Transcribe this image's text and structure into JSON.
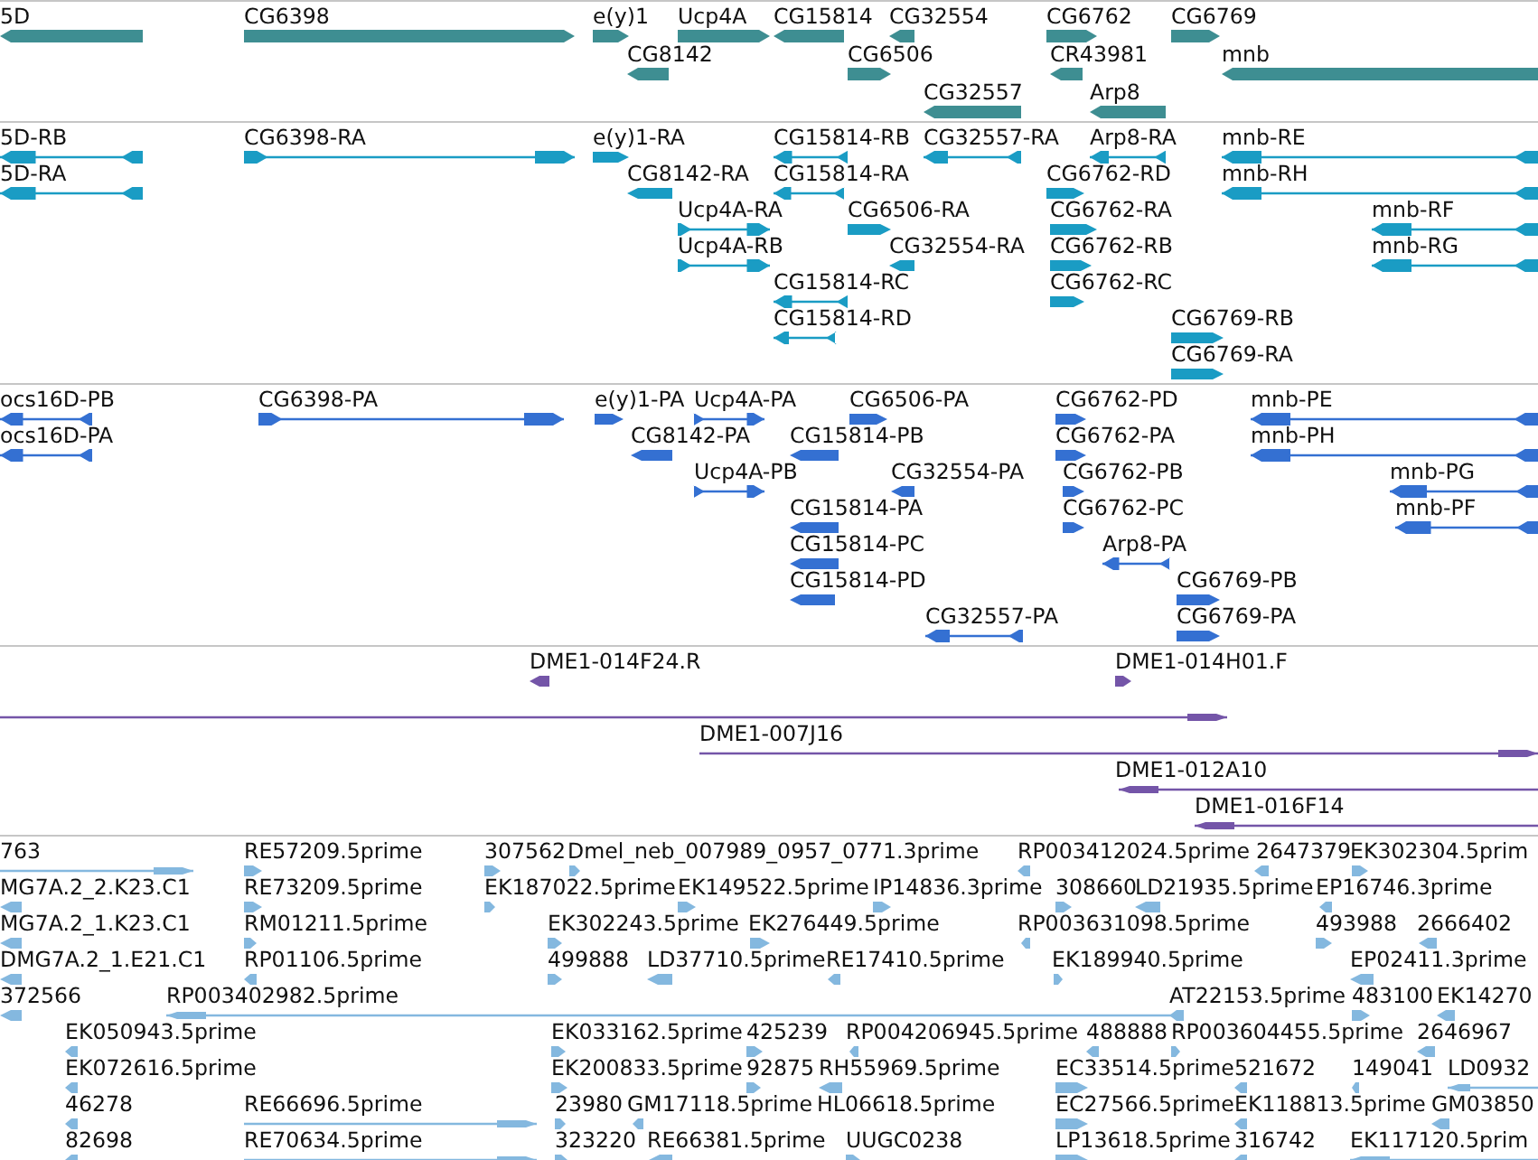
{
  "tracks": [
    {
      "kind": "gene",
      "color": "#3e8e92",
      "features": [
        {
          "label": "5D",
          "forward": false
        },
        {
          "label": "CG6398",
          "forward": true
        },
        {
          "label": "e(y)1",
          "forward": true
        },
        {
          "label": "Ucp4A",
          "forward": true
        },
        {
          "label": "CG15814",
          "forward": false
        },
        {
          "label": "CG32554",
          "forward": false
        },
        {
          "label": "CG6762",
          "forward": true
        },
        {
          "label": "CG6769",
          "forward": true
        },
        {
          "label": "CG8142",
          "forward": false
        },
        {
          "label": "CG6506",
          "forward": true
        },
        {
          "label": "CR43981",
          "forward": false
        },
        {
          "label": "mnb",
          "forward": false
        },
        {
          "label": "CG32557",
          "forward": false
        },
        {
          "label": "Arp8",
          "forward": false
        }
      ]
    },
    {
      "kind": "transcript",
      "color": "#1a9cc4",
      "features": [
        {
          "label": "5D-RB",
          "forward": false
        },
        {
          "label": "CG6398-RA",
          "forward": true
        },
        {
          "label": "e(y)1-RA",
          "forward": true
        },
        {
          "label": "CG15814-RB",
          "forward": false
        },
        {
          "label": "CG32557-RA",
          "forward": false
        },
        {
          "label": "Arp8-RA",
          "forward": false
        },
        {
          "label": "mnb-RE",
          "forward": false
        },
        {
          "label": "5D-RA",
          "forward": false
        },
        {
          "label": "CG8142-RA",
          "forward": false
        },
        {
          "label": "CG15814-RA",
          "forward": false
        },
        {
          "label": "CG6762-RD",
          "forward": true
        },
        {
          "label": "mnb-RH",
          "forward": false
        },
        {
          "label": "Ucp4A-RA",
          "forward": true
        },
        {
          "label": "CG6506-RA",
          "forward": true
        },
        {
          "label": "CG6762-RA",
          "forward": true
        },
        {
          "label": "mnb-RF",
          "forward": false
        },
        {
          "label": "Ucp4A-RB",
          "forward": true
        },
        {
          "label": "CG32554-RA",
          "forward": false
        },
        {
          "label": "CG6762-RB",
          "forward": true
        },
        {
          "label": "mnb-RG",
          "forward": false
        },
        {
          "label": "CG15814-RC",
          "forward": false
        },
        {
          "label": "CG6762-RC",
          "forward": true
        },
        {
          "label": "CG15814-RD",
          "forward": false
        },
        {
          "label": "CG6769-RB",
          "forward": true
        },
        {
          "label": "CG6769-RA",
          "forward": true
        }
      ]
    },
    {
      "kind": "protein",
      "color": "#3470d2",
      "features": [
        {
          "label": "ocs16D-PB",
          "forward": false
        },
        {
          "label": "CG6398-PA",
          "forward": true
        },
        {
          "label": "e(y)1-PA",
          "forward": true
        },
        {
          "label": "Ucp4A-PA",
          "forward": true
        },
        {
          "label": "CG6506-PA",
          "forward": true
        },
        {
          "label": "CG6762-PD",
          "forward": true
        },
        {
          "label": "mnb-PE",
          "forward": false
        },
        {
          "label": "ocs16D-PA",
          "forward": false
        },
        {
          "label": "CG8142-PA",
          "forward": false
        },
        {
          "label": "CG15814-PB",
          "forward": false
        },
        {
          "label": "CG6762-PA",
          "forward": true
        },
        {
          "label": "mnb-PH",
          "forward": false
        },
        {
          "label": "Ucp4A-PB",
          "forward": true
        },
        {
          "label": "CG32554-PA",
          "forward": false
        },
        {
          "label": "CG6762-PB",
          "forward": true
        },
        {
          "label": "mnb-PG",
          "forward": false
        },
        {
          "label": "CG15814-PA",
          "forward": false
        },
        {
          "label": "CG6762-PC",
          "forward": true
        },
        {
          "label": "mnb-PF",
          "forward": false
        },
        {
          "label": "CG15814-PC",
          "forward": false
        },
        {
          "label": "Arp8-PA",
          "forward": false
        },
        {
          "label": "CG15814-PD",
          "forward": false
        },
        {
          "label": "CG6769-PB",
          "forward": true
        },
        {
          "label": "CG32557-PA",
          "forward": false
        },
        {
          "label": "CG6769-PA",
          "forward": true
        }
      ]
    },
    {
      "kind": "clone",
      "color": "#7455a8",
      "features": [
        {
          "label": "DME1-014F24.R",
          "forward": false
        },
        {
          "label": "DME1-014H01.F",
          "forward": true
        },
        {
          "forward": true
        },
        {
          "label": "DME1-007J16",
          "forward": true
        },
        {
          "label": "DME1-012A10",
          "forward": false
        },
        {
          "label": "DME1-016F14",
          "forward": false
        }
      ]
    },
    {
      "kind": "est",
      "color": "#84b8df",
      "features": [
        {
          "label": "763",
          "forward": true
        },
        {
          "label": "RE57209.5prime",
          "forward": true
        },
        {
          "label": "307562",
          "forward": true
        },
        {
          "label": "Dmel_neb_007989_0957_0771.3prime",
          "forward": true
        },
        {
          "label": "RP003412024.5prime",
          "forward": false
        },
        {
          "label": "2647379",
          "forward": false
        },
        {
          "label": "EK302304.5prim",
          "forward": true
        },
        {
          "label": "MG7A.2_2.K23.C1",
          "forward": false
        },
        {
          "label": "RE73209.5prime",
          "forward": true
        },
        {
          "label": "EK187022.5prime",
          "forward": true
        },
        {
          "label": "EK149522.5prime",
          "forward": true
        },
        {
          "label": "IP14836.3prime",
          "forward": true
        },
        {
          "label": "308660",
          "forward": true
        },
        {
          "label": "LD21935.5prime",
          "forward": false
        },
        {
          "label": "EP16746.3prime",
          "forward": false
        },
        {
          "label": "MG7A.2_1.K23.C1",
          "forward": false
        },
        {
          "label": "RM01211.5prime",
          "forward": true
        },
        {
          "label": "EK302243.5prime",
          "forward": true
        },
        {
          "label": "EK276449.5prime",
          "forward": true
        },
        {
          "label": "RP003631098.5prime",
          "forward": false
        },
        {
          "label": "493988",
          "forward": true
        },
        {
          "label": "2666402",
          "forward": false
        },
        {
          "label": "DMG7A.2_1.E21.C1",
          "forward": false
        },
        {
          "label": "RP01106.5prime",
          "forward": false
        },
        {
          "label": "499888",
          "forward": true
        },
        {
          "label": "LD37710.5prime",
          "forward": false
        },
        {
          "label": "RE17410.5prime",
          "forward": false
        },
        {
          "label": "EK189940.5prime",
          "forward": true
        },
        {
          "label": "EP02411.3prime",
          "forward": false
        },
        {
          "label": "372566",
          "forward": false
        },
        {
          "label": "RP003402982.5prime",
          "forward": false
        },
        {
          "label": "AT22153.5prime",
          "forward": false
        },
        {
          "label": "483100",
          "forward": true
        },
        {
          "label": "EK14270",
          "forward": false
        },
        {
          "label": "EK050943.5prime",
          "forward": false
        },
        {
          "label": "EK033162.5prime",
          "forward": true
        },
        {
          "label": "425239",
          "forward": true
        },
        {
          "label": "RP004206945.5prime",
          "forward": false
        },
        {
          "label": "488888",
          "forward": false
        },
        {
          "label": "RP003604455.5prime",
          "forward": true
        },
        {
          "label": "2646967",
          "forward": false
        },
        {
          "label": "EK072616.5prime",
          "forward": false
        },
        {
          "label": "EK200833.5prime",
          "forward": true
        },
        {
          "label": "92875",
          "forward": true
        },
        {
          "label": "RH55969.5prime",
          "forward": false
        },
        {
          "label": "EC33514.5prime",
          "forward": true
        },
        {
          "label": "521672",
          "forward": false
        },
        {
          "label": "149041",
          "forward": false
        },
        {
          "label": "LD0932",
          "forward": false
        },
        {
          "label": "46278",
          "forward": false
        },
        {
          "label": "RE66696.5prime",
          "forward": true
        },
        {
          "label": "23980",
          "forward": true
        },
        {
          "label": "GM17118.5prime",
          "forward": false
        },
        {
          "label": "HL06618.5prime"
        },
        {
          "label": "EC27566.5prime",
          "forward": true
        },
        {
          "label": "EK118813.5prime",
          "forward": false
        },
        {
          "label": "GM03850",
          "forward": false
        },
        {
          "label": "82698",
          "forward": false
        },
        {
          "label": "RE70634.5prime",
          "forward": true
        },
        {
          "label": "323220",
          "forward": true
        },
        {
          "label": "RE66381.5prime",
          "forward": false
        },
        {
          "label": "UUGC0238",
          "forward": true
        },
        {
          "label": "LP13618.5prime",
          "forward": true
        },
        {
          "label": "316742",
          "forward": false
        },
        {
          "label": "EK117120.5prim",
          "forward": false
        }
      ]
    }
  ]
}
